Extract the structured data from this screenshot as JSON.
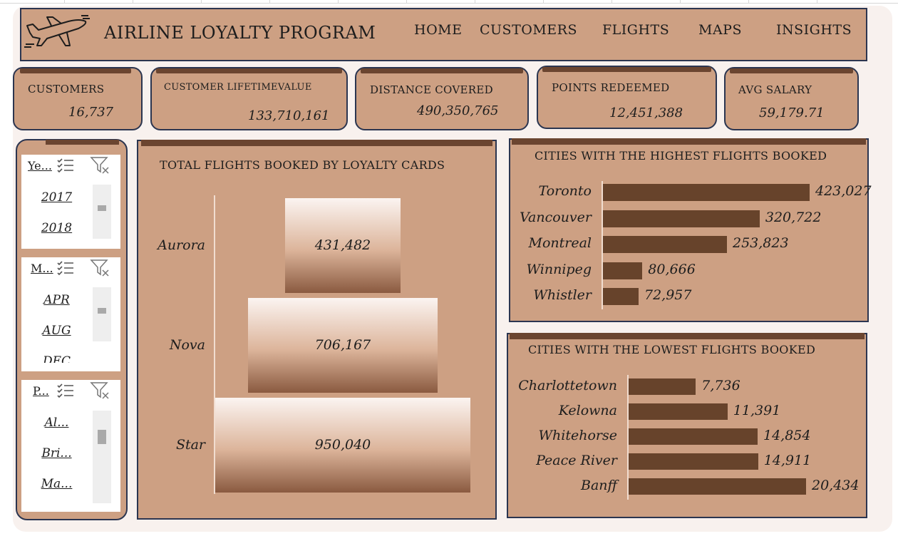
{
  "header": {
    "title": "AIRLINE LOYALTY PROGRAM",
    "icon": "airplane-icon",
    "nav": [
      "HOME",
      "CUSTOMERS",
      "FLIGHTS",
      "MAPS",
      "INSIGHTS"
    ]
  },
  "kpis": [
    {
      "label": "CUSTOMERS",
      "value": "16,737"
    },
    {
      "label": "CUSTOMER LIFETIMEVALUE",
      "value": "133,710,161"
    },
    {
      "label": "DISTANCE COVERED",
      "value": "490,350,765"
    },
    {
      "label": "POINTS REDEEMED",
      "value": "12,451,388"
    },
    {
      "label": "AVG SALARY",
      "value": "59,179.71"
    }
  ],
  "slicers": [
    {
      "header": "Ye...",
      "items": [
        "2017",
        "2018"
      ],
      "scroll_position": 0.3
    },
    {
      "header": "M...",
      "items": [
        "APR",
        "AUG",
        "DEC"
      ],
      "scroll_position": 0.3
    },
    {
      "header": "P...",
      "items": [
        "Al...",
        "Bri...",
        "Ma..."
      ],
      "scroll_position": 0.2
    }
  ],
  "funnel_chart": {
    "title": "TOTAL FLIGHTS BOOKED BY  LOYALTY CARDS",
    "bar_gradient": [
      "#fbf4f1",
      "#dcb49a",
      "#8a5a40"
    ]
  },
  "top_cities": {
    "title": "CITIES WITH THE HIGHEST FLIGHTS BOOKED"
  },
  "bottom_cities": {
    "title": "CITIES WITH THE LOWEST FLIGHTS BOOKED"
  },
  "colors": {
    "card": "#cda083",
    "accent_bar": "#6b4530",
    "bar": "#67432b",
    "border": "#2b3550",
    "background": "#f8f1ee"
  },
  "chart_data": [
    {
      "type": "bar",
      "orientation": "horizontal",
      "title": "TOTAL FLIGHTS BOOKED BY  LOYALTY CARDS",
      "categories": [
        "Aurora",
        "Nova",
        "Star"
      ],
      "values": [
        431482,
        706167,
        950040
      ],
      "labels": [
        "431,482",
        "706,167",
        "950,040"
      ]
    },
    {
      "type": "bar",
      "orientation": "horizontal",
      "title": "CITIES WITH THE HIGHEST FLIGHTS BOOKED",
      "categories": [
        "Toronto",
        "Vancouver",
        "Montreal",
        "Winnipeg",
        "Whistler"
      ],
      "values": [
        423027,
        320722,
        253823,
        80666,
        72957
      ],
      "labels": [
        "423,027",
        "320,722",
        "253,823",
        "80,666",
        "72,957"
      ]
    },
    {
      "type": "bar",
      "orientation": "horizontal",
      "title": "CITIES WITH THE LOWEST FLIGHTS BOOKED",
      "categories": [
        "Charlottetown",
        "Kelowna",
        "Whitehorse",
        "Peace River",
        "Banff"
      ],
      "values": [
        7736,
        11391,
        14854,
        14911,
        20434
      ],
      "labels": [
        "7,736",
        "11,391",
        "14,854",
        "14,911",
        "20,434"
      ]
    }
  ]
}
